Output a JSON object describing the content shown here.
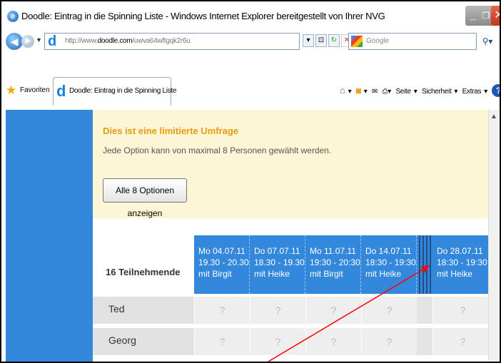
{
  "window": {
    "title": "Doodle: Eintrag in die Spinning Liste - Windows Internet Explorer bereitgestellt von Ihrer NVG"
  },
  "address_bar": {
    "url_prefix": "http://www.",
    "url_domain": "doodle.com",
    "url_path": "/uwva64wftgqk2r6u",
    "search_placeholder": "Google"
  },
  "favorites_bar": {
    "favorites_label": "Favoriten",
    "tab_label": "Doodle: Eintrag in die Spinning Liste",
    "commands": {
      "page": "Seite",
      "safety": "Sicherheit",
      "extras": "Extras"
    }
  },
  "notice": {
    "title": "Dies ist eine limitierte Umfrage",
    "text": "Jede Option kann von maximal 8 Personen gewählt werden.",
    "button": "Alle 8 Optionen anzeigen"
  },
  "poll": {
    "participants_label": "16 Teilnehmende",
    "options": [
      {
        "date": "Mo 04.07.11",
        "time": "19.30 - 20.30",
        "with": "mit Birgit"
      },
      {
        "date": "Do 07.07.11",
        "time": "18.30 - 19.30",
        "with": "mit Heike"
      },
      {
        "date": "Mo 11.07.11",
        "time": "19:30 - 20:30",
        "with": "mit Birgit"
      },
      {
        "date": "Do 14.07.11",
        "time": "18:30 - 19:30",
        "with": "mit Heike"
      },
      {
        "date": "Do 28.07.11",
        "time": "18:30 - 19:30",
        "with": "mit Heike"
      }
    ],
    "participants": [
      {
        "name": "Ted",
        "cells": [
          "?",
          "?",
          "?",
          "?",
          "?"
        ]
      },
      {
        "name": "Georg",
        "cells": [
          "?",
          "?",
          "?",
          "?",
          "?"
        ]
      }
    ]
  },
  "annotation": {
    "arrow_color": "#ff0000"
  }
}
